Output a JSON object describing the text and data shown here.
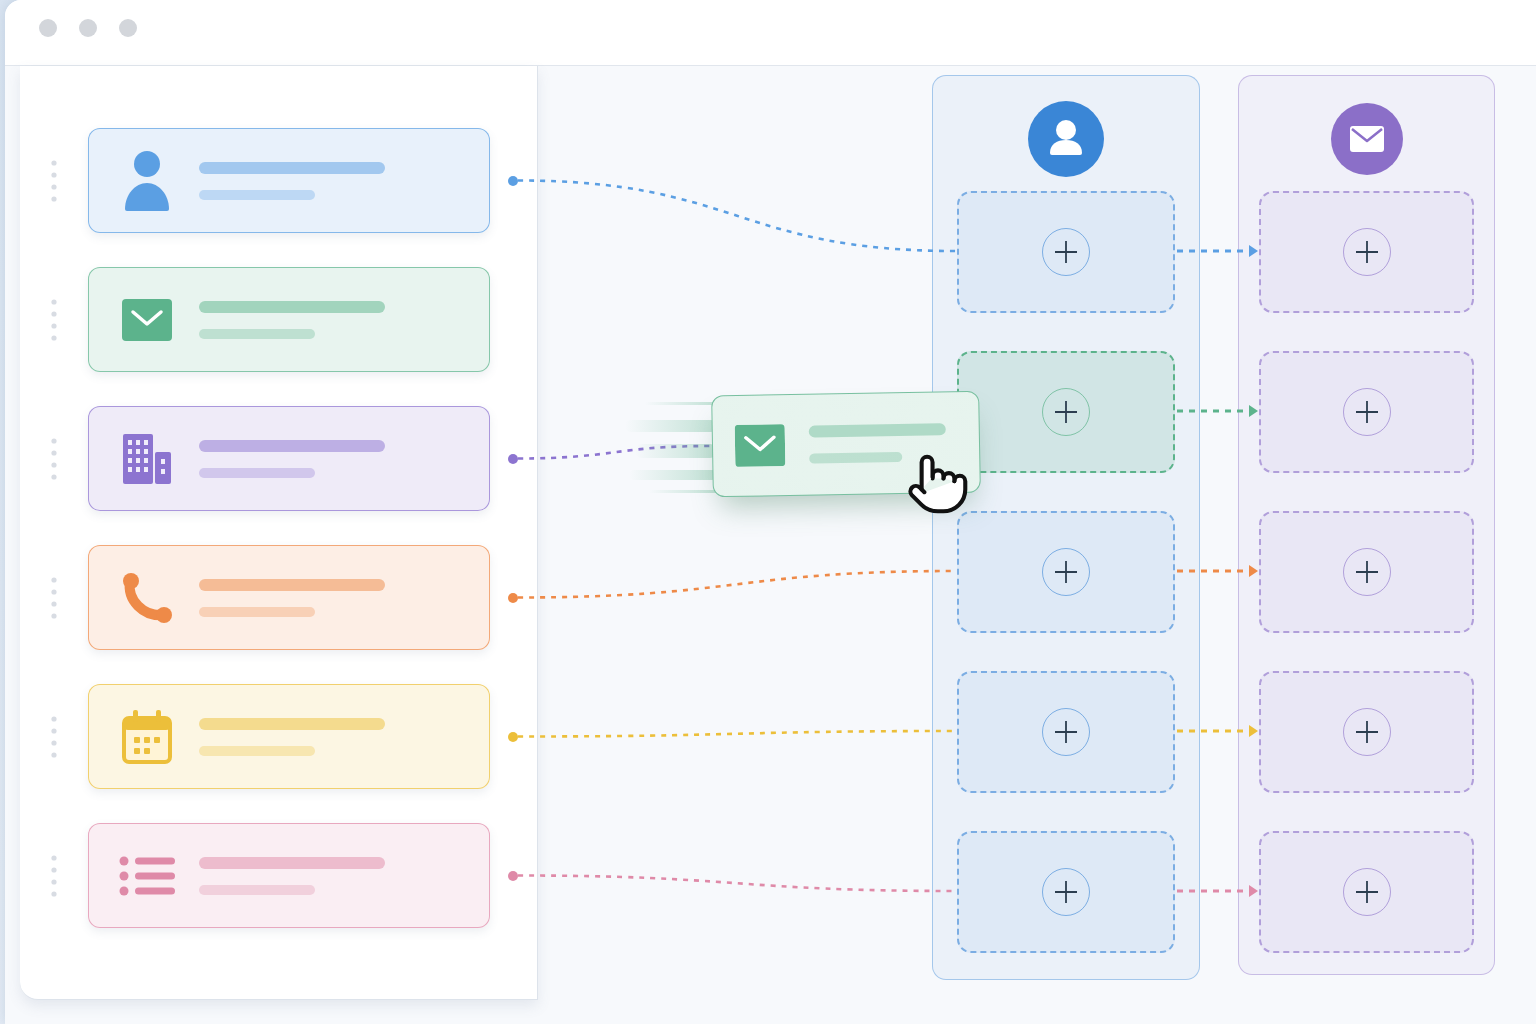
{
  "source_cards": [
    {
      "kind": "person",
      "color": "#5b9fe3",
      "connected": true
    },
    {
      "kind": "mail",
      "color": "#5cb38c",
      "connected": false
    },
    {
      "kind": "building",
      "color": "#8c74d0",
      "connected": true
    },
    {
      "kind": "phone",
      "color": "#ee8a48",
      "connected": true
    },
    {
      "kind": "calendar",
      "color": "#ecbf3a",
      "connected": true
    },
    {
      "kind": "list",
      "color": "#df8aa8",
      "connected": true
    }
  ],
  "dragged_card": {
    "kind": "mail",
    "color": "#5cb38c",
    "linked": true
  },
  "columns": [
    {
      "kind": "person",
      "color": "#3a86d6",
      "slots": [
        {
          "drop_target": false,
          "linked": true
        },
        {
          "drop_target": true,
          "linked": false
        },
        {
          "drop_target": false,
          "linked": true
        },
        {
          "drop_target": false,
          "linked": true
        },
        {
          "drop_target": false,
          "linked": true
        }
      ]
    },
    {
      "kind": "mail",
      "color": "#8b6fc8",
      "slots": [
        {
          "drop_target": false,
          "linked": true
        },
        {
          "drop_target": false,
          "linked": true
        },
        {
          "drop_target": false,
          "linked": true
        },
        {
          "drop_target": false,
          "linked": true
        },
        {
          "drop_target": false,
          "linked": true
        }
      ]
    }
  ]
}
